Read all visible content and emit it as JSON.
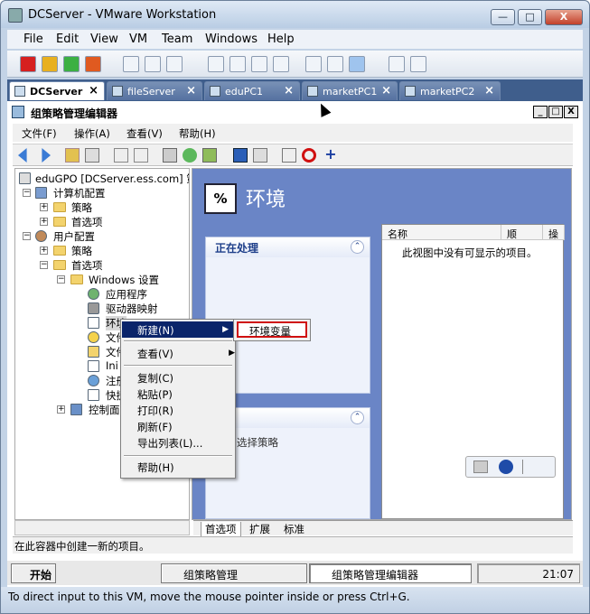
{
  "window": {
    "title": "DCServer - VMware Workstation",
    "minimize_label": "—",
    "maximize_label": "□",
    "close_label": "X"
  },
  "menubar": [
    "File",
    "Edit",
    "View",
    "VM",
    "Team",
    "Windows",
    "Help"
  ],
  "vm_tabs": [
    {
      "label": "DCServer",
      "active": true
    },
    {
      "label": "fileServer",
      "active": false
    },
    {
      "label": "eduPC1",
      "active": false
    },
    {
      "label": "marketPC1",
      "active": false
    },
    {
      "label": "marketPC2",
      "active": false
    }
  ],
  "tab_close_glyph": "×",
  "mmc": {
    "title": "组策略管理编辑器",
    "min_label": "_",
    "max_label": "□",
    "close_label": "X",
    "menus": [
      "文件(F)",
      "操作(A)",
      "查看(V)",
      "帮助(H)"
    ]
  },
  "tree": {
    "root": "eduGPO [DCServer.ess.com] 策",
    "computer_config": "计算机配置",
    "policies": "策略",
    "preferences": "首选项",
    "user_config": "用户配置",
    "windows_settings": "Windows 设置",
    "applications": "应用程序",
    "drive_maps": "驱动器映射",
    "environment": "环境",
    "files": "文件",
    "folders": "文件",
    "ini": "Ini",
    "registry": "注册",
    "shortcuts": "快捷",
    "control_panel": "控制面"
  },
  "context_menu": {
    "new": "新建(N)",
    "view": "查看(V)",
    "copy": "复制(C)",
    "paste": "粘贴(P)",
    "print": "打印(R)",
    "refresh": "刷新(F)",
    "export": "导出列表(L)...",
    "help": "帮助(H)"
  },
  "submenu": {
    "env_var": "环境变量"
  },
  "right_pane": {
    "title": "环境",
    "icon_text": "%",
    "processing_header": "正在处理",
    "second_box_header": "述",
    "second_box_text": "选择策略",
    "collapse_glyph": "⌃",
    "columns": [
      "名称",
      "顺",
      "操"
    ],
    "empty_text": "此视图中没有可显示的项目。"
  },
  "bottom_tabs": [
    "首选项",
    "扩展",
    "标准"
  ],
  "status_text": "在此容器中创建一新的项目。",
  "taskbar": {
    "start": "开始",
    "items": [
      "组策略管理",
      "组策略管理编辑器"
    ],
    "clock": "21:07"
  },
  "vm_status": "To direct input to this VM, move the mouse pointer inside or press Ctrl+G."
}
